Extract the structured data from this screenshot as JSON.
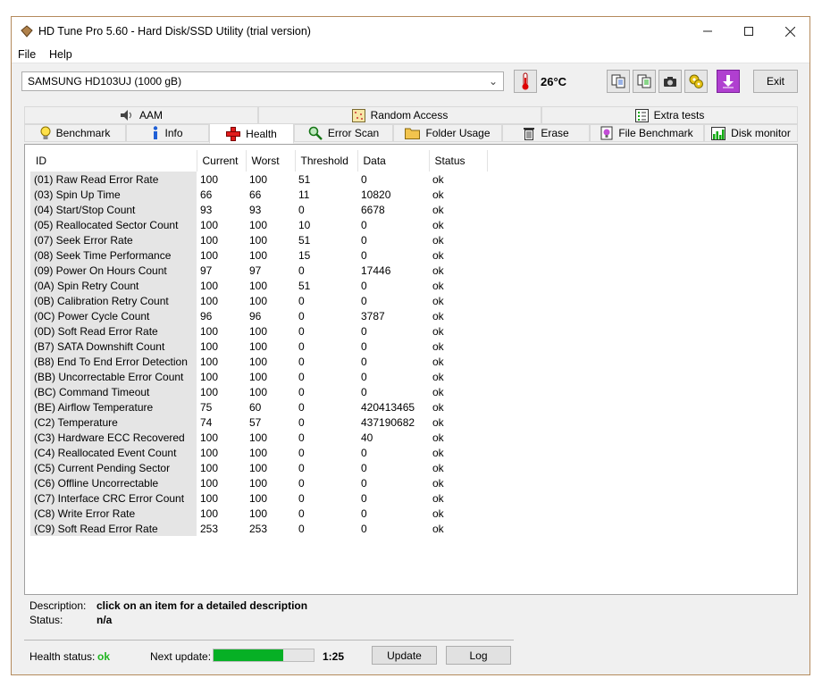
{
  "window": {
    "title": "HD Tune Pro 5.60 - Hard Disk/SSD Utility (trial version)"
  },
  "menu": {
    "file": "File",
    "help": "Help"
  },
  "toolbar": {
    "drive": "SAMSUNG HD103UJ (1000 gB)",
    "temperature": "26°C",
    "exit_label": "Exit"
  },
  "tabs": {
    "row1": [
      {
        "label": "AAM",
        "icon": "speaker-icon"
      },
      {
        "label": "Random Access",
        "icon": "random-access-icon"
      },
      {
        "label": "Extra tests",
        "icon": "extra-tests-icon"
      }
    ],
    "row2": [
      {
        "label": "Benchmark",
        "icon": "bulb-icon"
      },
      {
        "label": "Info",
        "icon": "info-icon"
      },
      {
        "label": "Health",
        "icon": "health-cross-icon"
      },
      {
        "label": "Error Scan",
        "icon": "magnifier-icon"
      },
      {
        "label": "Folder Usage",
        "icon": "folder-icon"
      },
      {
        "label": "Erase",
        "icon": "trash-icon"
      },
      {
        "label": "File Benchmark",
        "icon": "file-benchmark-icon"
      },
      {
        "label": "Disk monitor",
        "icon": "chart-icon"
      }
    ],
    "active": "Health"
  },
  "table": {
    "headers": [
      "ID",
      "Current",
      "Worst",
      "Threshold",
      "Data",
      "Status"
    ],
    "rows": [
      [
        "(01) Raw Read Error Rate",
        "100",
        "100",
        "51",
        "0",
        "ok"
      ],
      [
        "(03) Spin Up Time",
        "66",
        "66",
        "11",
        "10820",
        "ok"
      ],
      [
        "(04) Start/Stop Count",
        "93",
        "93",
        "0",
        "6678",
        "ok"
      ],
      [
        "(05) Reallocated Sector Count",
        "100",
        "100",
        "10",
        "0",
        "ok"
      ],
      [
        "(07) Seek Error Rate",
        "100",
        "100",
        "51",
        "0",
        "ok"
      ],
      [
        "(08) Seek Time Performance",
        "100",
        "100",
        "15",
        "0",
        "ok"
      ],
      [
        "(09) Power On Hours Count",
        "97",
        "97",
        "0",
        "17446",
        "ok"
      ],
      [
        "(0A) Spin Retry Count",
        "100",
        "100",
        "51",
        "0",
        "ok"
      ],
      [
        "(0B) Calibration Retry Count",
        "100",
        "100",
        "0",
        "0",
        "ok"
      ],
      [
        "(0C) Power Cycle Count",
        "96",
        "96",
        "0",
        "3787",
        "ok"
      ],
      [
        "(0D) Soft Read Error Rate",
        "100",
        "100",
        "0",
        "0",
        "ok"
      ],
      [
        "(B7) SATA Downshift Count",
        "100",
        "100",
        "0",
        "0",
        "ok"
      ],
      [
        "(B8) End To End Error Detection",
        "100",
        "100",
        "0",
        "0",
        "ok"
      ],
      [
        "(BB) Uncorrectable Error Count",
        "100",
        "100",
        "0",
        "0",
        "ok"
      ],
      [
        "(BC) Command Timeout",
        "100",
        "100",
        "0",
        "0",
        "ok"
      ],
      [
        "(BE) Airflow Temperature",
        "75",
        "60",
        "0",
        "420413465",
        "ok"
      ],
      [
        "(C2) Temperature",
        "74",
        "57",
        "0",
        "437190682",
        "ok"
      ],
      [
        "(C3) Hardware ECC Recovered",
        "100",
        "100",
        "0",
        "40",
        "ok"
      ],
      [
        "(C4) Reallocated Event Count",
        "100",
        "100",
        "0",
        "0",
        "ok"
      ],
      [
        "(C5) Current Pending Sector",
        "100",
        "100",
        "0",
        "0",
        "ok"
      ],
      [
        "(C6) Offline Uncorrectable",
        "100",
        "100",
        "0",
        "0",
        "ok"
      ],
      [
        "(C7) Interface CRC Error Count",
        "100",
        "100",
        "0",
        "0",
        "ok"
      ],
      [
        "(C8) Write Error Rate",
        "100",
        "100",
        "0",
        "0",
        "ok"
      ],
      [
        "(C9) Soft Read Error Rate",
        "253",
        "253",
        "0",
        "0",
        "ok"
      ]
    ]
  },
  "details": {
    "description_label": "Description:",
    "description_value": "click on an item for a detailed description",
    "status_label": "Status:",
    "status_value": "n/a"
  },
  "footer": {
    "health_label": "Health status:",
    "health_value": "ok",
    "next_update_label": "Next update:",
    "next_update_progress": 0.7,
    "timer": "1:25",
    "update_label": "Update",
    "log_label": "Log"
  },
  "colors": {
    "health_ok": "#1fb51f",
    "progress": "#06b025",
    "window_border": "#b48a5c"
  }
}
